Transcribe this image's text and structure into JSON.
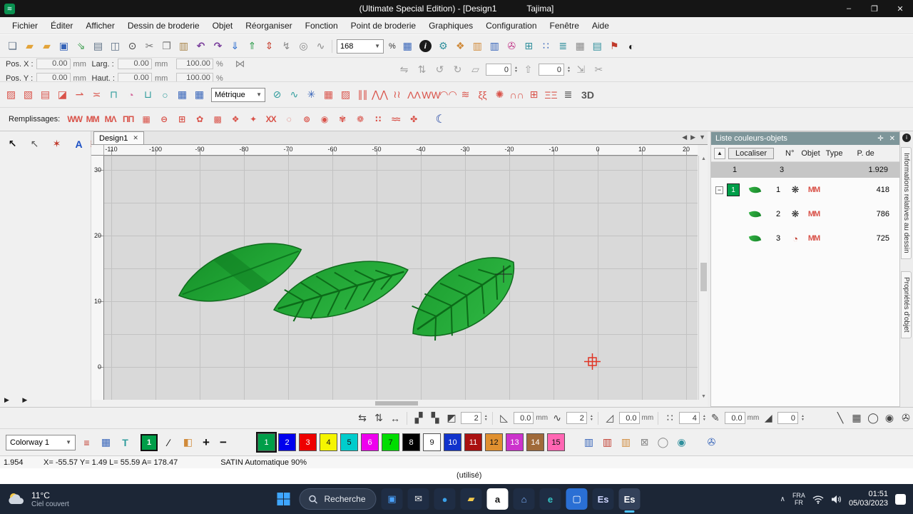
{
  "colors": {
    "leaf_green": "#1f9e30",
    "leaf_dark": "#0d6e1b",
    "accent_green": "#009e49",
    "toolbar_red": "#d9534a",
    "taskbar_bg": "#1c2636",
    "panel_header_bg": "#7e969a"
  },
  "titlebar": {
    "title": "(Ultimate Special Edition) - [Design1",
    "app": "Tajima]",
    "minimize": "–",
    "maximize": "❐",
    "close": "✕"
  },
  "menu": {
    "items": [
      "Fichier",
      "Éditer",
      "Afficher",
      "Dessin de broderie",
      "Objet",
      "Réorganiser",
      "Fonction",
      "Point de broderie",
      "Graphiques",
      "Configuration",
      "Fenêtre",
      "Aide"
    ]
  },
  "toolbar_main": {
    "zoom_value": "168",
    "percent": "%",
    "icons_left": [
      {
        "name": "new-file-icon",
        "glyph": "❏",
        "color": "#5f7186"
      },
      {
        "name": "open-folder-icon",
        "glyph": "▰",
        "color": "#e3a43a"
      },
      {
        "name": "open-recent-icon",
        "glyph": "▰",
        "color": "#e3a43a"
      },
      {
        "name": "save-icon",
        "glyph": "▣",
        "color": "#3563b8"
      },
      {
        "name": "send-to-machine-icon",
        "glyph": "⇘",
        "color": "#3a9c4c"
      },
      {
        "name": "print-icon",
        "glyph": "▤",
        "color": "#5f7186"
      },
      {
        "name": "print-preview-icon",
        "glyph": "◫",
        "color": "#5f7186"
      },
      {
        "name": "zoom-tool-icon",
        "glyph": "⊙",
        "color": "#444444"
      },
      {
        "name": "cut-icon",
        "glyph": "✂",
        "color": "#777777"
      },
      {
        "name": "copy-icon",
        "glyph": "❐",
        "color": "#777777"
      },
      {
        "name": "paste-icon",
        "glyph": "▥",
        "color": "#a8854a"
      },
      {
        "name": "undo-icon",
        "glyph": "↶",
        "color": "#7a3f9c",
        "bold": true
      },
      {
        "name": "redo-icon",
        "glyph": "↷",
        "color": "#7a3f9c",
        "bold": true
      },
      {
        "name": "import-design-icon",
        "glyph": "⇓",
        "color": "#2f6fd0"
      },
      {
        "name": "export-design-icon",
        "glyph": "⇑",
        "color": "#2f9c4c"
      },
      {
        "name": "machine-queue-icon",
        "glyph": "⇕",
        "color": "#c94a3a"
      },
      {
        "name": "hook-icon",
        "glyph": "↯",
        "color": "#8a8a8a"
      },
      {
        "name": "hoop-icon",
        "glyph": "◎",
        "color": "#8a8a8a"
      },
      {
        "name": "slow-redraw-icon",
        "glyph": "∿",
        "color": "#8a8a8a"
      }
    ],
    "icons_right": [
      {
        "name": "grid-settings-icon",
        "glyph": "▦",
        "color": "#3563b8"
      },
      {
        "name": "info-icon",
        "glyph": "i",
        "color": "#ffffff",
        "bg": "#1a1a1a",
        "round": true
      },
      {
        "name": "machine-settings-icon",
        "glyph": "⚙",
        "color": "#2f8f9c"
      },
      {
        "name": "design-properties-icon",
        "glyph": "❖",
        "color": "#d08a3a"
      },
      {
        "name": "color-report-icon",
        "glyph": "▥",
        "color": "#d08a3a"
      },
      {
        "name": "thread-chart-icon",
        "glyph": "▥",
        "color": "#3563b8"
      },
      {
        "name": "thread-spool-icon",
        "glyph": "✇",
        "color": "#c23a8a"
      },
      {
        "name": "hoop-select-icon",
        "glyph": "⊞",
        "color": "#2f8f9c"
      },
      {
        "name": "stitch-points-icon",
        "glyph": "∷",
        "color": "#3563b8"
      },
      {
        "name": "density-icon",
        "glyph": "≣",
        "color": "#2f8f9c"
      },
      {
        "name": "grid-icon",
        "glyph": "▦",
        "color": "#8a8a8a"
      },
      {
        "name": "measure-icon",
        "glyph": "▤",
        "color": "#2f8f9c"
      },
      {
        "name": "stamp-icon",
        "glyph": "⚑",
        "color": "#c0392b"
      },
      {
        "name": "contrast-icon",
        "glyph": "◐",
        "color": "#1a1a1a"
      }
    ]
  },
  "pos_panel": {
    "pos_x_label": "Pos. X :",
    "pos_y_label": "Pos. Y :",
    "larg_label": "Larg. :",
    "haut_label": "Haut. :",
    "pos_x": "0.00",
    "pos_y": "0.00",
    "larg": "0.00",
    "haut": "0.00",
    "scale_x": "100.00",
    "scale_y": "100.00",
    "mm": "mm",
    "pct": "%",
    "chain_glyph": "⋈",
    "rotate_value": "0",
    "nudge_value": "0",
    "icons_a": [
      {
        "name": "mirror-h-icon",
        "glyph": "⇋"
      },
      {
        "name": "mirror-v-icon",
        "glyph": "⇅"
      },
      {
        "name": "rotate-left-icon",
        "glyph": "↺"
      },
      {
        "name": "rotate-right-icon",
        "glyph": "↻"
      },
      {
        "name": "skew-icon",
        "glyph": "▱"
      }
    ],
    "icons_b": [
      {
        "name": "scale-icon",
        "glyph": "⇲"
      },
      {
        "name": "split-icon",
        "glyph": "✂"
      }
    ]
  },
  "stitch_bar": {
    "unit_value": "Métrique",
    "label_3d": "3D",
    "icons_left": [
      {
        "name": "run-stitch-icon",
        "glyph": "▨",
        "color": "#d9534a"
      },
      {
        "name": "steil-stitch-icon",
        "glyph": "▧",
        "color": "#d9534a"
      },
      {
        "name": "satin-stitch-icon",
        "glyph": "▤",
        "color": "#d9534a"
      },
      {
        "name": "fill-stitch-icon",
        "glyph": "◪",
        "color": "#d9534a"
      },
      {
        "name": "pull-comp-icon",
        "glyph": "⇀",
        "color": "#d9534a"
      },
      {
        "name": "underlay-icon",
        "glyph": "≍",
        "color": "#d9534a"
      },
      {
        "name": "lettering-icon",
        "glyph": "⊓",
        "color": "#2f9c9c"
      },
      {
        "name": "monogram-icon",
        "glyph": "◔",
        "color": "#d46a9c"
      },
      {
        "name": "applique-icon",
        "glyph": "⊔",
        "color": "#2f9c9c"
      },
      {
        "name": "ellipse-tool-icon",
        "glyph": "○",
        "color": "#2f9c9c"
      },
      {
        "name": "table-icon",
        "glyph": "▦",
        "color": "#3563b8"
      },
      {
        "name": "table-alt-icon",
        "glyph": "▦",
        "color": "#3563b8"
      }
    ],
    "icons_right": [
      {
        "name": "circle-pen-icon",
        "glyph": "⊘",
        "color": "#2f9c9c"
      },
      {
        "name": "curve-pen-icon",
        "glyph": "∿",
        "color": "#2f9c9c"
      },
      {
        "name": "snowflake-icon",
        "glyph": "✳",
        "color": "#3563b8"
      },
      {
        "name": "cross-stitch-icon",
        "glyph": "▦",
        "color": "#d9534a"
      },
      {
        "name": "pattern-fill-icon",
        "glyph": "▨",
        "color": "#d9534a"
      },
      {
        "name": "satin-columns-icon",
        "glyph": "∥∥",
        "color": "#d9534a"
      },
      {
        "name": "motif-run-icon",
        "glyph": "⋀⋀",
        "color": "#d9534a"
      },
      {
        "name": "wave-fill-icon",
        "glyph": "≀≀",
        "color": "#d9534a"
      },
      {
        "name": "chevron-fill-icon",
        "glyph": "ΛΛ",
        "color": "#d9534a"
      },
      {
        "name": "zigzag-icon",
        "glyph": "WW",
        "color": "#d9534a"
      },
      {
        "name": "arc-fill-icon",
        "glyph": "◠◠",
        "color": "#d9534a"
      },
      {
        "name": "ripple-icon",
        "glyph": "≋",
        "color": "#d9534a"
      },
      {
        "name": "meander-icon",
        "glyph": "ξξ",
        "color": "#d9534a"
      },
      {
        "name": "radial-fill-icon",
        "glyph": "✺",
        "color": "#d9534a"
      },
      {
        "name": "scallop-icon",
        "glyph": "∩∩",
        "color": "#d9534a"
      },
      {
        "name": "grid-fill-icon",
        "glyph": "⊞",
        "color": "#d9534a"
      },
      {
        "name": "ladder-icon",
        "glyph": "ΞΞ",
        "color": "#d9534a"
      },
      {
        "name": "lines-icon",
        "glyph": "≣",
        "color": "#555555"
      }
    ]
  },
  "fills_bar": {
    "label": "Remplissages:",
    "icons": [
      {
        "name": "fill-zigzag-icon",
        "glyph": "WW"
      },
      {
        "name": "fill-m-icon",
        "glyph": "MM"
      },
      {
        "name": "fill-mv-icon",
        "glyph": "ΜΛ"
      },
      {
        "name": "fill-pi-icon",
        "glyph": "ΠΠ"
      },
      {
        "name": "fill-grid-icon",
        "glyph": "▦"
      },
      {
        "name": "fill-rings-icon",
        "glyph": "⊖"
      },
      {
        "name": "fill-box-icon",
        "glyph": "⊞"
      },
      {
        "name": "fill-flower-icon",
        "glyph": "✿"
      },
      {
        "name": "fill-weave-icon",
        "glyph": "▩"
      },
      {
        "name": "fill-diamond-icon",
        "glyph": "❖"
      },
      {
        "name": "fill-star-icon",
        "glyph": "✦"
      },
      {
        "name": "fill-x-icon",
        "glyph": "XX"
      },
      {
        "name": "fill-spiral-icon",
        "glyph": "◌"
      },
      {
        "name": "fill-swirl-icon",
        "glyph": "⊚"
      },
      {
        "name": "fill-target-icon",
        "glyph": "◉"
      },
      {
        "name": "fill-rose-icon",
        "glyph": "✾"
      },
      {
        "name": "fill-petals-icon",
        "glyph": "❁"
      },
      {
        "name": "fill-dots-icon",
        "glyph": "∷"
      },
      {
        "name": "fill-waves-icon",
        "glyph": "≈≈"
      },
      {
        "name": "fill-cross-icon",
        "glyph": "✤"
      }
    ],
    "moon": {
      "name": "night-fill-icon",
      "glyph": "☾",
      "color": "#1a3fa0"
    }
  },
  "toolbox": {
    "more": "▶ ▶",
    "tools": [
      {
        "name": "select-tool",
        "glyph": "↖",
        "color": "#111111",
        "bold": true
      },
      {
        "name": "edit-points-tool",
        "glyph": "↖",
        "color": "#555555"
      },
      {
        "name": "magic-wand-tool",
        "glyph": "✶",
        "color": "#c0392b"
      },
      {
        "name": "lettering-tool",
        "glyph": "A",
        "color": "#1a4fc4",
        "bold": true
      },
      {
        "name": "sequence-tool",
        "glyph": "≣",
        "color": "#c0392b"
      },
      {
        "name": "shape-tool",
        "glyph": "◈",
        "color": "#5b6ee1"
      },
      {
        "name": "circle-tool",
        "glyph": "◉",
        "color": "#222222"
      },
      {
        "name": "donut-tool",
        "glyph": "◎",
        "color": "#222222"
      },
      {
        "name": "spiral-tool",
        "glyph": "◌",
        "color": "#555555"
      },
      {
        "name": "hexagon-tool",
        "glyph": "◇",
        "color": "#c0392b",
        "bold": true
      },
      {
        "name": "sphere-tool",
        "glyph": "●",
        "color": "#999999"
      },
      {
        "name": "stipple-tool",
        "glyph": "∵",
        "color": "#c0392b"
      },
      {
        "name": "pencil-tool",
        "glyph": "✎",
        "color": "#444444"
      },
      {
        "name": "bezier-tool",
        "glyph": "∿",
        "color": "#444444"
      },
      {
        "name": "lasso-tool",
        "glyph": "↺",
        "color": "#444444"
      },
      {
        "name": "ruler-tool",
        "glyph": "◺",
        "color": "#444444"
      },
      {
        "name": "pen-tool",
        "glyph": "✐",
        "color": "#444444"
      },
      {
        "name": "digitize-home-tool",
        "glyph": "⌂",
        "color": "#444444"
      },
      {
        "name": "circle-draw-tool",
        "glyph": "○",
        "color": "#444444"
      },
      {
        "name": "arc-tool",
        "glyph": "◠",
        "color": "#444444"
      },
      {
        "name": "triangle-tool",
        "glyph": "△",
        "color": "#444444"
      },
      {
        "name": "compass-tool",
        "glyph": "Λ",
        "color": "#444444"
      },
      {
        "name": "wave-tool",
        "glyph": "≈",
        "color": "#444444"
      },
      {
        "name": "s-curve-tool",
        "glyph": "∫",
        "color": "#444444"
      },
      {
        "name": "pointer-tool",
        "glyph": "↖",
        "color": "#111111",
        "active": true,
        "bold": true
      },
      {
        "name": "zoom-in-tool",
        "glyph": "⊕",
        "color": "#333333"
      },
      {
        "name": "zoom-out-tool",
        "glyph": "⊖",
        "color": "#333333"
      },
      {
        "name": "pan-tool",
        "glyph": "✥",
        "color": "#333333"
      },
      {
        "name": "measure-tool",
        "glyph": "✛",
        "color": "#333333"
      },
      {
        "name": "origin-tool",
        "glyph": "✚",
        "color": "#c0392b"
      },
      {
        "name": "insert-point-tool",
        "glyph": "∴",
        "color": "#c0392b"
      },
      {
        "name": "blue-pen-tool",
        "glyph": "✎",
        "color": "#2a5bd7"
      },
      {
        "name": "red-pen-tool",
        "glyph": "✎",
        "color": "#d7402a"
      },
      {
        "name": "gear-tool",
        "glyph": "✺",
        "color": "#d7402a"
      },
      {
        "name": "swirl-tool",
        "glyph": "✾",
        "color": "#d7402a"
      },
      {
        "name": "moon-tool",
        "glyph": "☽",
        "color": "#d7402a"
      },
      {
        "name": "arrow-alt-tool",
        "glyph": "↗",
        "color": "#333333"
      },
      {
        "name": "hand-tool",
        "glyph": "↔",
        "color": "#333333"
      },
      {
        "name": "knife-tool",
        "glyph": "✄",
        "color": "#333333"
      },
      {
        "name": "crosshair-tool",
        "glyph": "✛",
        "color": "#333333"
      },
      {
        "name": "target-tool",
        "glyph": "◎",
        "color": "#333333"
      },
      {
        "name": "toolbox-slot-empty",
        "glyph": "",
        "color": "#333333"
      },
      {
        "name": "toolbox-slot-empty",
        "glyph": "",
        "color": "#333333"
      },
      {
        "name": "toolbox-slot-empty",
        "glyph": "",
        "color": "#333333"
      },
      {
        "name": "toolbox-slot-empty",
        "glyph": "",
        "color": "#333333"
      },
      {
        "name": "toolbox-slot-empty",
        "glyph": "",
        "color": "#333333"
      },
      {
        "name": "toolbox-slot-empty",
        "glyph": "",
        "color": "#333333"
      },
      {
        "name": "toolbox-slot-empty",
        "glyph": "",
        "color": "#333333"
      }
    ]
  },
  "canvas": {
    "tab": "Design1",
    "tab_close": "✕",
    "hruler": [
      "-110",
      "-100",
      "-90",
      "-80",
      "-70",
      "-60",
      "-50",
      "-40",
      "-30",
      "-20",
      "-10",
      "0",
      "10",
      "20"
    ],
    "vruler": [
      "30",
      "20",
      "10",
      "0"
    ]
  },
  "object_panel": {
    "title": "Liste couleurs-objets",
    "localiser": "Localiser",
    "columns": [
      "N°",
      "Objet",
      "Type",
      "P. de"
    ],
    "group_row": {
      "colorway": "1",
      "objects": "3",
      "stitches": "1.929"
    },
    "rows": [
      {
        "expand": "−",
        "chip": "1",
        "chip_color": "#009e49",
        "num": "1",
        "type": "❋",
        "type_color": "#222222",
        "stitch": "ΜΜ",
        "count": "418"
      },
      {
        "expand": "",
        "chip": "",
        "chip_color": "",
        "num": "2",
        "type": "❋",
        "type_color": "#222222",
        "stitch": "ΜΜ",
        "count": "786"
      },
      {
        "expand": "",
        "chip": "",
        "chip_color": "",
        "num": "3",
        "type": "◔",
        "type_color": "#c0392b",
        "stitch": "ΜΜ",
        "count": "725"
      }
    ]
  },
  "side_tabs": {
    "tab1": "Informations relatives au dessin",
    "tab2": "Propriétés d'objet"
  },
  "align_bar": {
    "fields": [
      {
        "value": "2"
      },
      {
        "value": "0.0",
        "unit": "mm"
      },
      {
        "value": "2"
      },
      {
        "value": "0.0",
        "unit": "mm"
      },
      {
        "value": "4"
      },
      {
        "value": "0.0",
        "unit": "mm"
      },
      {
        "value": "0"
      }
    ]
  },
  "palette": {
    "colorway": "Colorway 1",
    "current": "1",
    "chips": [
      {
        "n": "1",
        "color": "#009e49",
        "tc": "#ffffff",
        "selected": true
      },
      {
        "n": "2",
        "color": "#0000ee",
        "tc": "#ffffff"
      },
      {
        "n": "3",
        "color": "#ee0000",
        "tc": "#ffffff"
      },
      {
        "n": "4",
        "color": "#f5f500",
        "tc": "#111111"
      },
      {
        "n": "5",
        "color": "#00cccc",
        "tc": "#111111"
      },
      {
        "n": "6",
        "color": "#ee00ee",
        "tc": "#ffffff"
      },
      {
        "n": "7",
        "color": "#00dd00",
        "tc": "#111111"
      },
      {
        "n": "8",
        "color": "#000000",
        "tc": "#ffffff"
      },
      {
        "n": "9",
        "color": "#ffffff",
        "tc": "#111111"
      },
      {
        "n": "10",
        "color": "#1133cc",
        "tc": "#ffffff"
      },
      {
        "n": "11",
        "color": "#aa1111",
        "tc": "#ffffff"
      },
      {
        "n": "12",
        "color": "#e09030",
        "tc": "#111111"
      },
      {
        "n": "13",
        "color": "#cc33cc",
        "tc": "#ffffff"
      },
      {
        "n": "14",
        "color": "#a06a3a",
        "tc": "#ffffff"
      },
      {
        "n": "15",
        "color": "#ff66b3",
        "tc": "#111111"
      }
    ]
  },
  "statusbar": {
    "count": "1.954",
    "coords": "X=  -55.57 Y=    1.49 L=   55.59 A=  178.47",
    "mode": "SATIN Automatique 90%",
    "used": "(utilisé)"
  },
  "taskbar": {
    "weather_temp": "11°C",
    "weather_desc": "Ciel couvert",
    "search_placeholder": "Recherche",
    "apps": [
      {
        "name": "pinned-app-icon",
        "glyph": "▣",
        "bg": "#1f2d44",
        "fg": "#4aa3ff"
      },
      {
        "name": "mail-app-icon",
        "glyph": "✉",
        "bg": "#1f2d44",
        "fg": "#e8e8e8"
      },
      {
        "name": "media-app-icon",
        "glyph": "●",
        "bg": "#1f2d44",
        "fg": "#3aa0e8"
      },
      {
        "name": "file-explorer-icon",
        "glyph": "▰",
        "bg": "#1f2d44",
        "fg": "#f2c94c"
      },
      {
        "name": "amazon-app-icon",
        "glyph": "a",
        "bg": "#ffffff",
        "fg": "#111111"
      },
      {
        "name": "home-app-icon",
        "glyph": "⌂",
        "bg": "#1f2d44",
        "fg": "#7fb3ff"
      },
      {
        "name": "edge-app-icon",
        "glyph": "e",
        "bg": "#1f2d44",
        "fg": "#35c4c4"
      },
      {
        "name": "monitor-app-icon",
        "glyph": "▢",
        "bg": "#2a6fd4",
        "fg": "#ffffff"
      },
      {
        "name": "embroidery-app-icon",
        "glyph": "Es",
        "bg": "#1f2d44",
        "fg": "#cfd6ff"
      },
      {
        "name": "embroidery-app-active-icon",
        "glyph": "Es",
        "bg": "#33415a",
        "fg": "#ffffff",
        "active": true
      }
    ],
    "lang_line1": "FRA",
    "lang_line2": "FR",
    "time": "01:51",
    "date": "05/03/2023"
  }
}
